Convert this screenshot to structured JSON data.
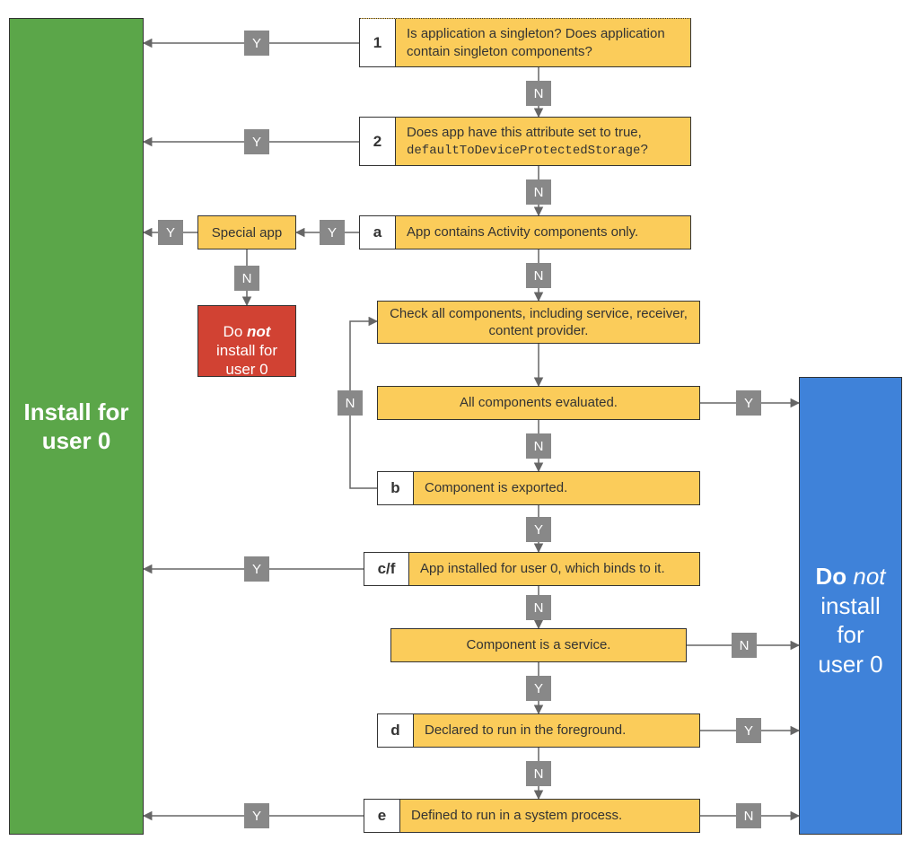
{
  "endpoints": {
    "install": "Install for\nuser 0",
    "do_not_prefix": "Do ",
    "do_not_em": "not",
    "do_not_rest": " install\nfor\nuser 0",
    "red_prefix": "Do ",
    "red_em": "not",
    "red_rest": "\ninstall for\nuser 0"
  },
  "nodes": {
    "n1": {
      "num": "1",
      "text": "Is application a singleton? Does application contain singleton components?"
    },
    "n2": {
      "num": "2",
      "text_before": "Does app have this attribute set to true, ",
      "code": "defaultToDeviceProtectedStorage",
      "text_after": "?"
    },
    "na": {
      "num": "a",
      "text": "App contains Activity components only."
    },
    "special": "Special app",
    "check_all": "Check all components, including service, receiver, content provider.",
    "all_eval": "All components evaluated.",
    "nb": {
      "num": "b",
      "text": "Component is exported."
    },
    "ncf": {
      "num": "c/f",
      "text": "App installed for user 0, which binds to it."
    },
    "comp_service": "Component is a service.",
    "nd": {
      "num": "d",
      "text": "Declared to run in the foreground."
    },
    "ne": {
      "num": "e",
      "text": "Defined to run in a system process."
    }
  },
  "labels": {
    "Y": "Y",
    "N": "N"
  }
}
